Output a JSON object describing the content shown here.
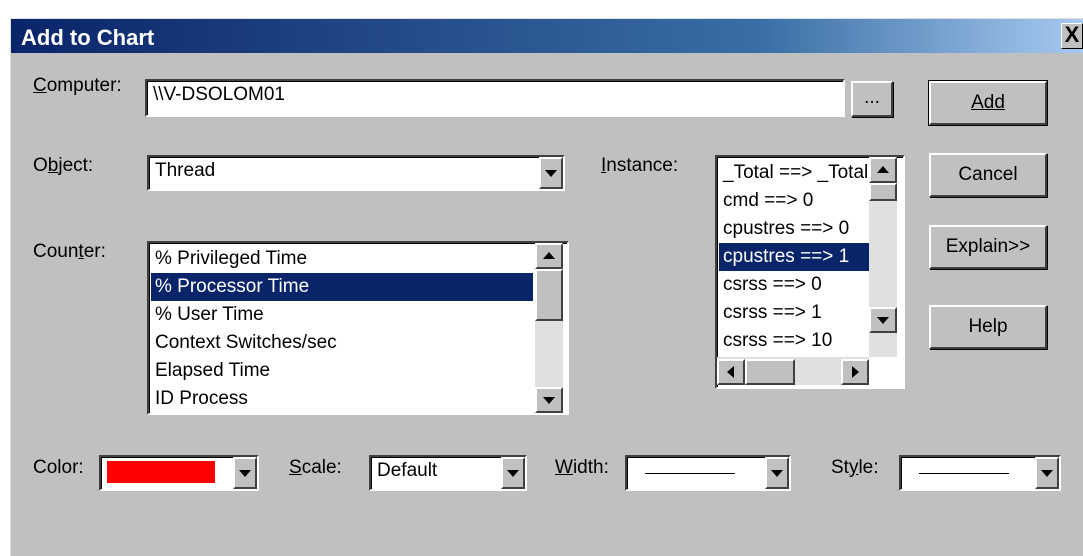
{
  "dialog": {
    "title": "Add to Chart",
    "close_label": "X"
  },
  "computer": {
    "label": "Computer:",
    "value": "\\\\V-DSOLOM01",
    "browse_label": "..."
  },
  "object": {
    "label": "Object:",
    "value": "Thread"
  },
  "instance": {
    "label": "Instance:",
    "items": [
      "_Total ==> _Total",
      "cmd ==> 0",
      "cpustres ==> 0",
      "cpustres ==> 1",
      "csrss ==> 0",
      "csrss ==> 1",
      "csrss ==> 10"
    ],
    "selected_index": 3
  },
  "counter": {
    "label": "Counter:",
    "items": [
      "% Privileged Time",
      "% Processor Time",
      "% User Time",
      "Context Switches/sec",
      "Elapsed Time",
      "ID Process"
    ],
    "selected_index": 1
  },
  "buttons": {
    "add": "Add",
    "cancel": "Cancel",
    "explain": "Explain>>",
    "help": "Help"
  },
  "color": {
    "label": "Color:",
    "value": "#ff0000"
  },
  "scale": {
    "label": "Scale:",
    "value": "Default"
  },
  "width": {
    "label": "Width:"
  },
  "style": {
    "label": "Style:"
  }
}
